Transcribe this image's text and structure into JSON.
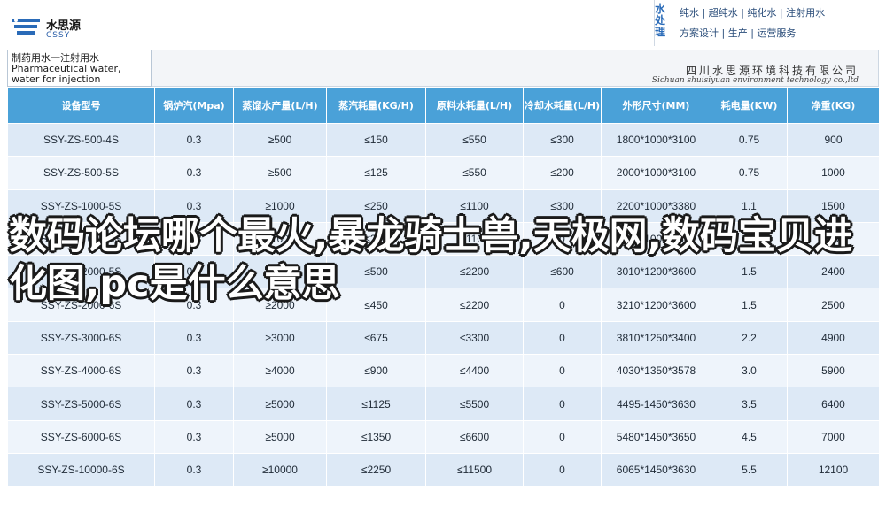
{
  "brand": {
    "name_cn": "水思源",
    "name_en": "CSSY",
    "accent": "#2a6bb8"
  },
  "services": {
    "brand_vertical": "水处理",
    "line1": "纯水 | 超纯水 | 纯化水 | 注射用水",
    "line2": "方案设计 | 生产 | 运营服务"
  },
  "product_title": "制药用水一注射用水 Pharmaceutical water, water for injection",
  "company": {
    "name_cn": "四川水思源环境科技有限公司",
    "name_en": "Sichuan shuisiyuan environment technology co.,ltd"
  },
  "table": {
    "headers": [
      "设备型号",
      "锅炉汽(Mpa)",
      "蒸馏水产量(L/H)",
      "蒸汽耗量(KG/H)",
      "原料水耗量(L/H)",
      "冷却水耗量(L/H)",
      "外形尺寸(MM)",
      "耗电量(KW)",
      "净重(KG)"
    ],
    "rows": [
      [
        "SSY-ZS-500-4S",
        "0.3",
        "≥500",
        "≤150",
        "≤550",
        "≤300",
        "1800*1000*3100",
        "0.75",
        "900"
      ],
      [
        "SSY-ZS-500-5S",
        "0.3",
        "≥500",
        "≤125",
        "≤550",
        "≤200",
        "2000*1000*3100",
        "0.75",
        "1000"
      ],
      [
        "SSY-ZS-1000-5S",
        "0.3",
        "≥1000",
        "≤250",
        "≤1100",
        "≤300",
        "2200*1000*3380",
        "1.1",
        "1500"
      ],
      [
        "SSY-ZS-1000-6S",
        "0.3",
        "≥1000",
        "≤200",
        "≤1100",
        "0",
        "2400*1000*3380",
        "1.1",
        "2000"
      ],
      [
        "SSY-ZS-2000-5S",
        "0.3",
        "≥2000",
        "≤500",
        "≤2200",
        "≤600",
        "3010*1200*3600",
        "1.5",
        "2400"
      ],
      [
        "SSY-ZS-2000-6S",
        "0.3",
        "≥2000",
        "≤450",
        "≤2200",
        "0",
        "3210*1200*3600",
        "1.5",
        "2500"
      ],
      [
        "SSY-ZS-3000-6S",
        "0.3",
        "≥3000",
        "≤675",
        "≤3300",
        "0",
        "3810*1250*3400",
        "2.2",
        "4900"
      ],
      [
        "SSY-ZS-4000-6S",
        "0.3",
        "≥4000",
        "≤900",
        "≤4400",
        "0",
        "4030*1350*3578",
        "3.0",
        "5900"
      ],
      [
        "SSY-ZS-5000-6S",
        "0.3",
        "≥5000",
        "≤1125",
        "≤5500",
        "0",
        "4495-1450*3630",
        "3.5",
        "6400"
      ],
      [
        "SSY-ZS-6000-6S",
        "0.3",
        "≥5000",
        "≤1350",
        "≤6600",
        "0",
        "5480*1450*3650",
        "4.5",
        "7000"
      ],
      [
        "SSY-ZS-10000-6S",
        "0.3",
        "≥10000",
        "≤2250",
        "≤11500",
        "0",
        "6065*1450*3630",
        "5.5",
        "12100"
      ]
    ]
  },
  "overlay_title": "数码论坛哪个最火,暴龙骑士兽,天极网,数码宝贝进化图,pc是什么意思"
}
